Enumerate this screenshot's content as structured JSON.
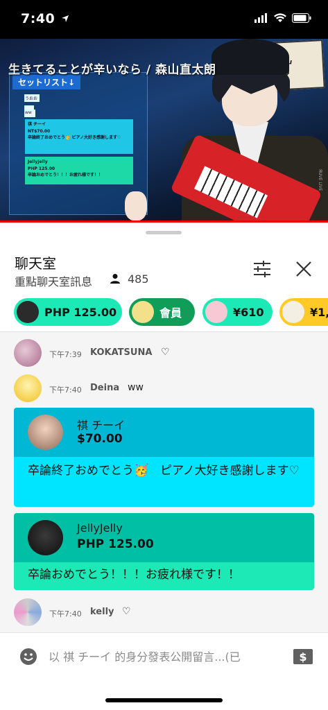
{
  "status_bar": {
    "time": "7:40"
  },
  "video": {
    "title": "生きてることが辛いなら / 森山直太朗",
    "setlist_label": "セットリスト↓",
    "sign_text": "モイッル",
    "sign_sub": "kanaeizuru",
    "sign_hash": "#奏イッル",
    "side_text": "ЯUVE LIVE",
    "mini_cards": [
      {
        "name": "祺 チーイ",
        "amount": "NT$70.00",
        "text": "卒論終了おめでとう🥳 ピアノ大好き感謝します♡"
      },
      {
        "name": "JellyJelly",
        "amount": "PHP 125.00",
        "text": "卒論おめでとう！！！お疲れ様です！！"
      }
    ],
    "mini_rows": [
      "うおお",
      "ww"
    ]
  },
  "chat_header": {
    "title": "聊天室",
    "subtitle": "重點聊天室訊息",
    "viewer_count": "485"
  },
  "chips": [
    {
      "label": "PHP 125.00",
      "color": "#1de9b6",
      "avatar_color": "#2b2b2b"
    },
    {
      "label": "會員",
      "color": "#0f9d58",
      "avatar_color": "#f2e08a"
    },
    {
      "label": "¥610",
      "color": "#1de9b6",
      "avatar_color": "#f8c8d4"
    },
    {
      "label": "¥1,",
      "color": "#ffca28",
      "avatar_color": "#f3efe2"
    }
  ],
  "messages": [
    {
      "time": "下午7:39",
      "author": "KOKATSUNA",
      "text": "♡"
    },
    {
      "time": "下午7:40",
      "author": "Deina",
      "text": "ww"
    }
  ],
  "superchats": [
    {
      "name": "祺 チーイ",
      "amount": "$70.00",
      "text": "卒論終了おめでとう🥳　ピアノ大好き感謝します♡",
      "head_color": "#00b8d4",
      "body_color": "#00e5ff"
    },
    {
      "name": "JellyJelly",
      "amount": "PHP 125.00",
      "text": "卒論おめでとう！！！お疲れ様です！！",
      "head_color": "#00bfa5",
      "body_color": "#1de9b6"
    }
  ],
  "last_message": {
    "time": "下午7:40",
    "author": "kelly",
    "text": "♡"
  },
  "input": {
    "placeholder": "以 祺 チーイ 的身分發表公開留言...(已"
  }
}
